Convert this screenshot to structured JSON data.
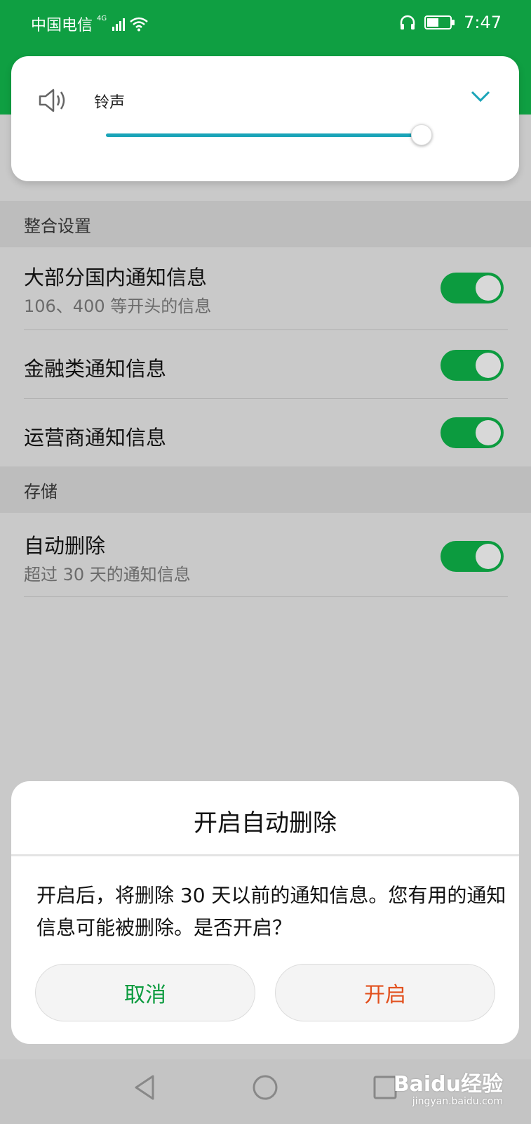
{
  "status_bar": {
    "carrier": "中国电信",
    "network": "4G",
    "time": "7:47"
  },
  "volume_panel": {
    "label": "铃声",
    "level_fraction": 0.99
  },
  "sections": {
    "integration": {
      "header": "整合设置",
      "items": [
        {
          "title": "大部分国内通知信息",
          "subtitle": "106、400 等开头的信息",
          "enabled": true
        },
        {
          "title": "金融类通知信息",
          "enabled": true
        },
        {
          "title": "运营商通知信息",
          "enabled": true
        }
      ]
    },
    "storage": {
      "header": "存储",
      "items": [
        {
          "title": "自动删除",
          "subtitle": "超过 30 天的通知信息",
          "enabled": true
        }
      ]
    }
  },
  "dialog": {
    "title": "开启自动删除",
    "message": "开启后，将删除 30 天以前的通知信息。您有用的通知信息可能被删除。是否开启？",
    "cancel_label": "取消",
    "confirm_label": "开启"
  },
  "watermark": {
    "brand": "Baidu经验",
    "site": "jingyan.baidu.com"
  },
  "colors": {
    "accent_green": "#0f9f42",
    "slider_teal": "#1aa4b8",
    "confirm_orange": "#e2501d"
  }
}
